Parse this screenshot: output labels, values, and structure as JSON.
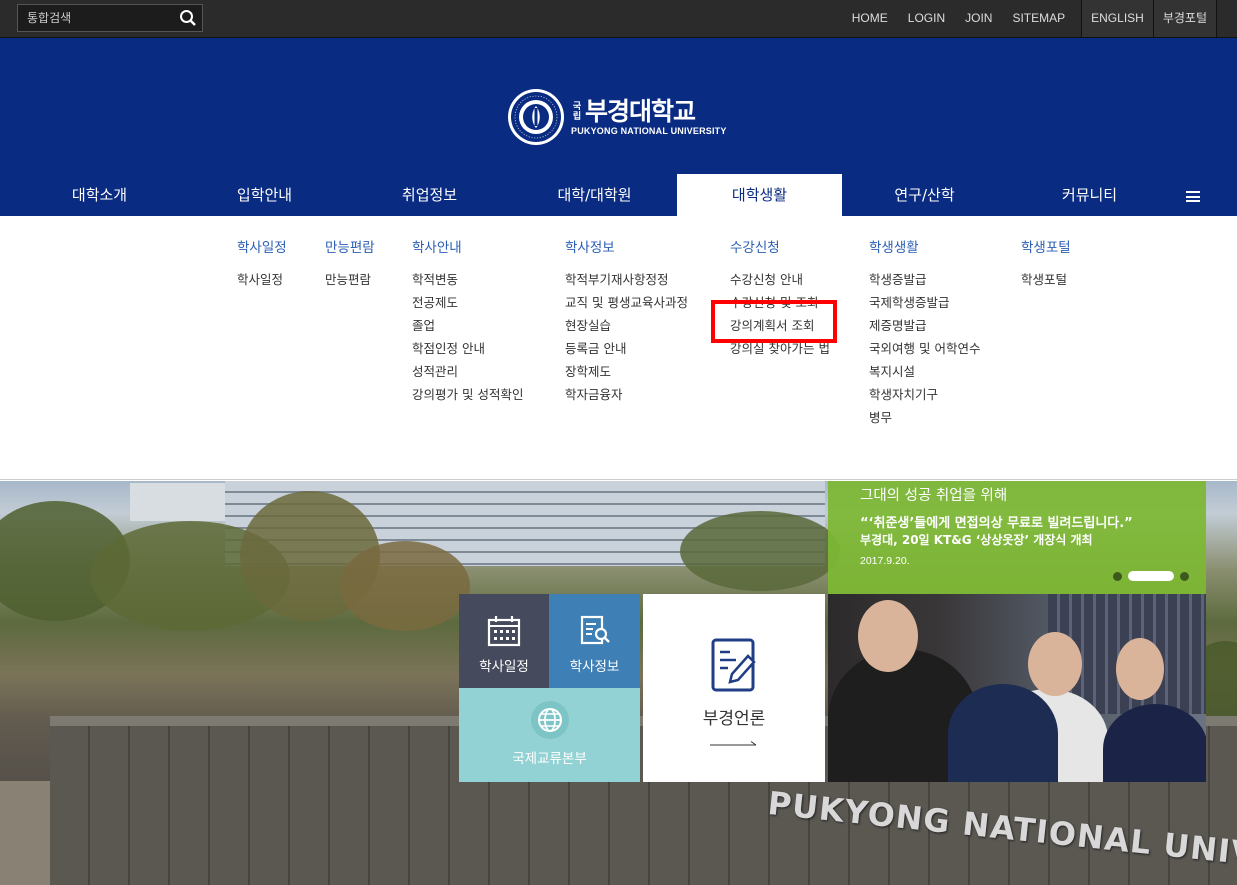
{
  "search": {
    "placeholder": "통합검색"
  },
  "top_links": [
    "HOME",
    "LOGIN",
    "JOIN",
    "SITEMAP",
    "ENGLISH",
    "부경포털"
  ],
  "logo": {
    "small_top": "국",
    "small_bottom": "립",
    "name": "부경대학교",
    "english": "PUKYONG NATIONAL UNIVERSITY"
  },
  "nav": [
    "대학소개",
    "입학안내",
    "취업정보",
    "대학/대학원",
    "대학생활",
    "연구/산학",
    "커뮤니티"
  ],
  "nav_active": "대학생활",
  "submenu": [
    {
      "title": "학사일정",
      "items": [
        "학사일정"
      ]
    },
    {
      "title": "만능편람",
      "items": [
        "만능편람"
      ]
    },
    {
      "title": "학사안내",
      "items": [
        "학적변동",
        "전공제도",
        "졸업",
        "학점인정 안내",
        "성적관리",
        "강의평가 및 성적확인"
      ]
    },
    {
      "title": "학사정보",
      "items": [
        "학적부기재사항정정",
        "교직 및 평생교육사과정",
        "현장실습",
        "등록금 안내",
        "장학제도",
        "학자금융자"
      ]
    },
    {
      "title": "수강신청",
      "items": [
        "수강신청 안내",
        "수강신청 및 조회",
        "강의계획서 조회",
        "강의실 찾아가는 법"
      ]
    },
    {
      "title": "학생생활",
      "items": [
        "학생증발급",
        "국제학생증발급",
        "제증명발급",
        "국외여행 및 어학연수",
        "복지시설",
        "학생자치기구",
        "병무"
      ]
    },
    {
      "title": "학생포털",
      "items": [
        "학생포털"
      ]
    }
  ],
  "highlight_label": "강의계획서 조회",
  "tiles": {
    "schedule": "학사일정",
    "info": "학사정보",
    "intl": "국제교류본부",
    "press": "부경언론"
  },
  "news": {
    "head": "그대의 성공 취업을 위해",
    "quote": "“‘취준생’들에게 면접의상 무료로 빌려드립니다.”",
    "sub": "부경대, 20일 KT&G ‘상상옷장’ 개장식 개최",
    "date": "2017.9.20."
  },
  "sign": "PUKYONG NATIONAL UNIVERSITY",
  "colors": {
    "primary": "#0a2b82",
    "submenu_title": "#2b5fb5",
    "highlight": "#ff0000",
    "news_bg": "#7db834"
  }
}
